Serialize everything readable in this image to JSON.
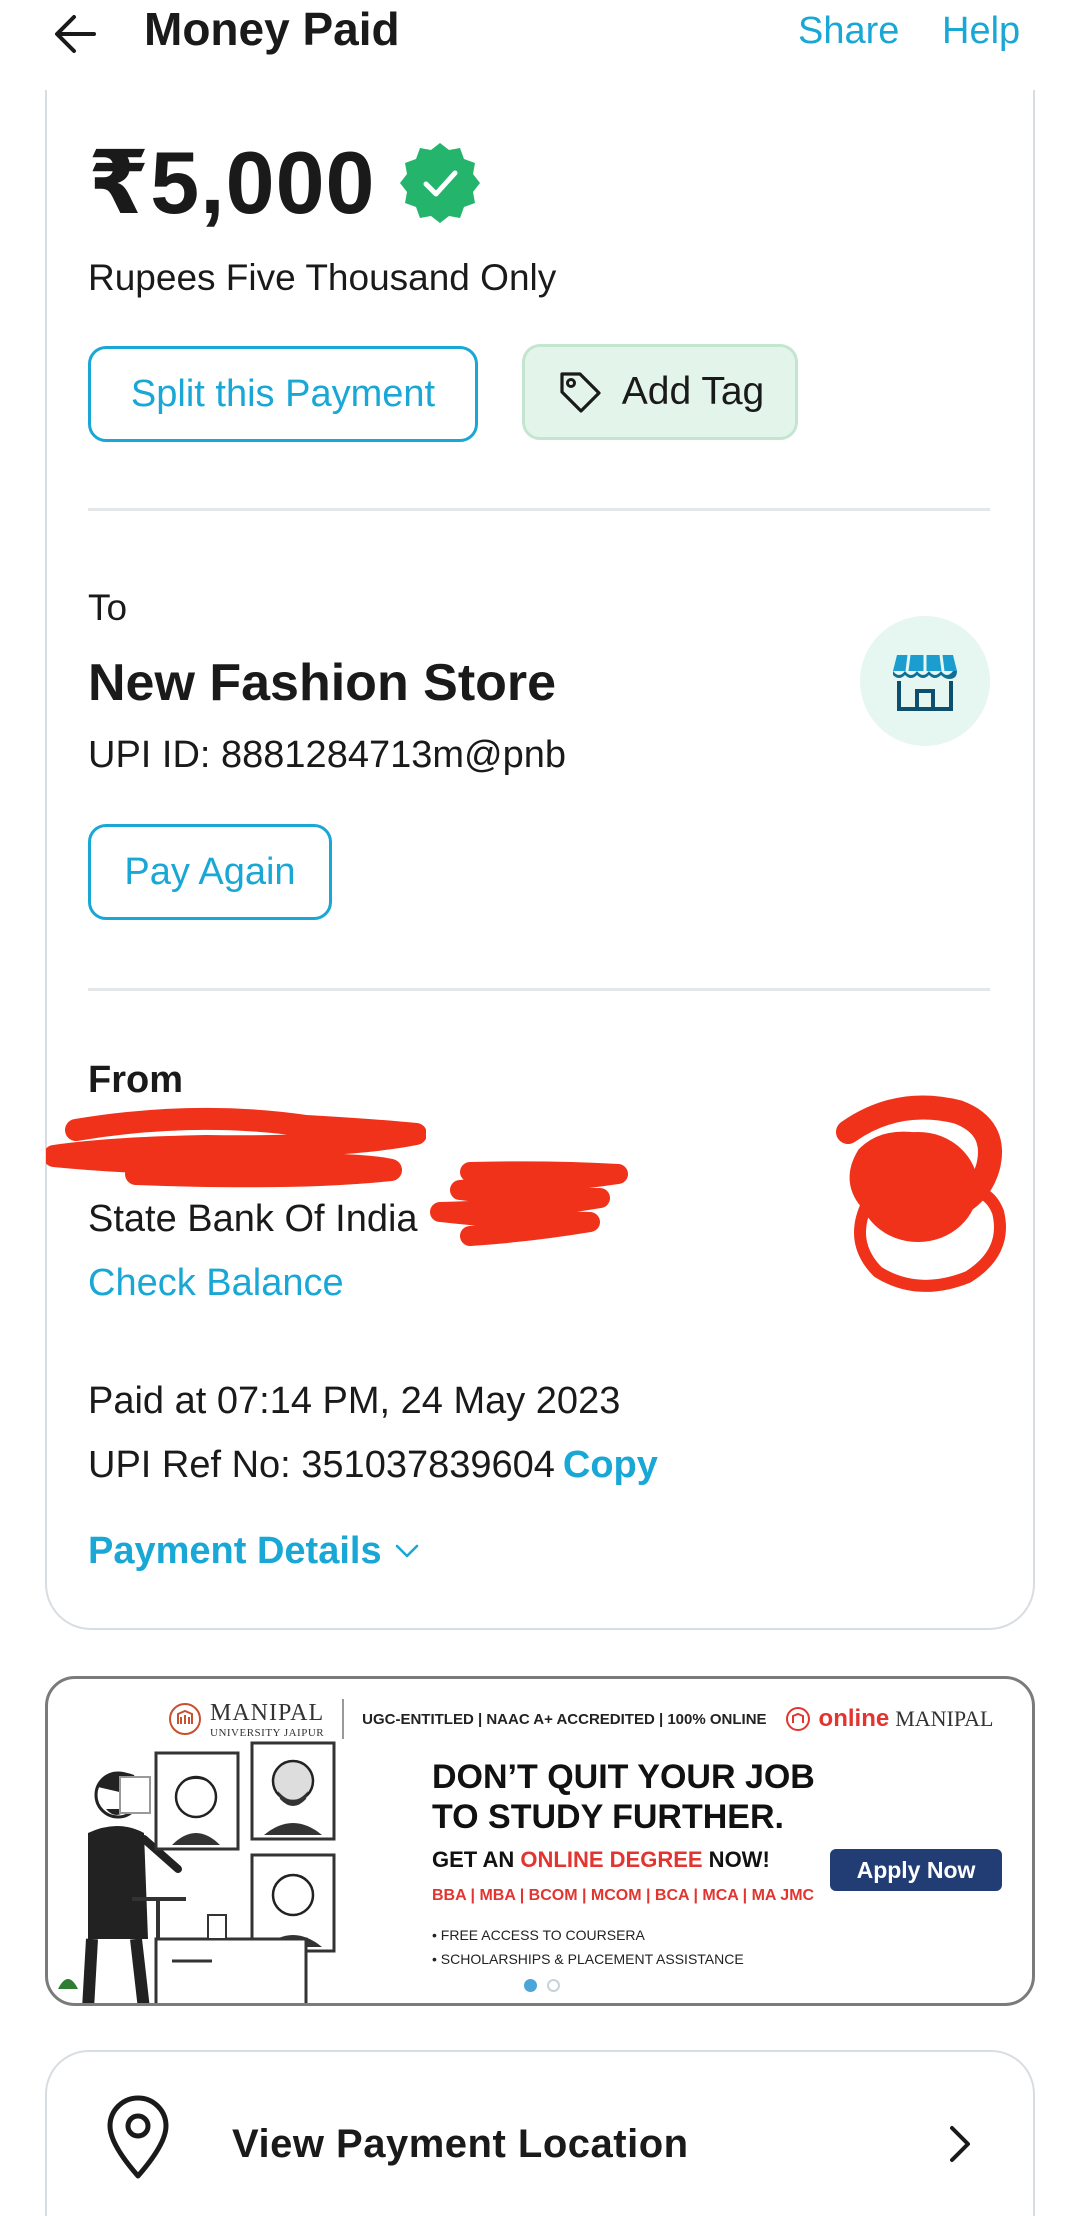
{
  "header": {
    "title": "Money Paid",
    "share_label": "Share",
    "help_label": "Help"
  },
  "payment": {
    "amount": "₹5,000",
    "amount_words": "Rupees Five Thousand Only",
    "split_label": "Split this Payment",
    "tag_label": "Add Tag"
  },
  "to": {
    "label": "To",
    "name": "New Fashion Store",
    "upi_id": "UPI ID: 8881284713m@pnb",
    "pay_again_label": "Pay Again"
  },
  "from": {
    "label": "From",
    "bank": "State Bank Of India",
    "check_balance_label": "Check Balance"
  },
  "details": {
    "paid_at": "Paid at 07:14 PM, 24 May 2023",
    "ref_no": "UPI Ref No: 351037839604",
    "copy_label": "Copy",
    "payment_details_label": "Payment Details"
  },
  "banner": {
    "logo_main": "MANIPAL",
    "logo_sub": "UNIVERSITY JAIPUR",
    "accreditation": "UGC-ENTITLED | NAAC A+ ACCREDITED | 100% ONLINE",
    "online_word": "online",
    "online_brand": "MANIPAL",
    "headline_1": "DON’T QUIT YOUR JOB",
    "headline_2": "TO STUDY FURTHER.",
    "sub_prefix": "GET AN ",
    "sub_highlight": "ONLINE DEGREE",
    "sub_suffix": " NOW!",
    "programs": "BBA | MBA | BCOM | MCOM | BCA | MCA | MA JMC",
    "bullet_1": "• FREE ACCESS TO COURSERA",
    "bullet_2": "• SCHOLARSHIPS & PLACEMENT ASSISTANCE",
    "apply_label": "Apply Now"
  },
  "location": {
    "label": "View Payment Location"
  },
  "colors": {
    "accent": "#19a7d6",
    "verified_green": "#25b46b",
    "tag_bg": "#e3f4ea",
    "redaction": "#f0321a"
  },
  "icons": [
    "back-arrow-icon",
    "verified-badge-icon",
    "tag-icon",
    "store-icon",
    "chevron-down-icon",
    "location-pin-icon",
    "chevron-right-icon"
  ]
}
